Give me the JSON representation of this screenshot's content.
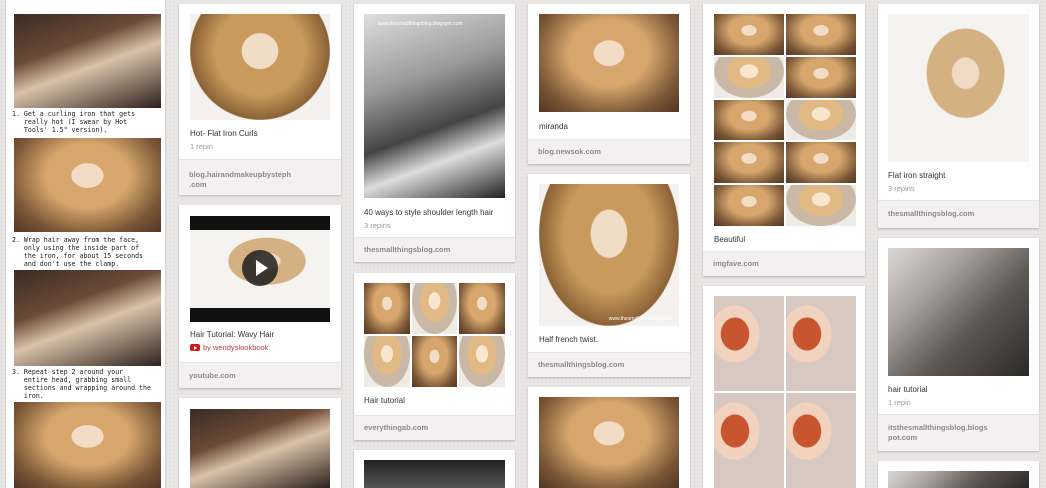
{
  "pins": {
    "c1": {
      "step1": "1. Get a curling iron that gets\n   really hot (I swear by Hot\n   Tools' 1.5\" version).",
      "step2": "2. Wrap hair away from the face,\n   only using the inside part of\n   the iron, for about 15 seconds\n   and don't use the clamp.",
      "step3": "3. Repeat step 2 around your\n   entire head, grabbing small\n   sections and wrapping around the\n   iron."
    },
    "c2a": {
      "desc": "Hot- Flat Iron Curls",
      "repins": "1 repin",
      "source": "blog.hairandmakeupbysteph\n.com"
    },
    "c2b": {
      "desc": "Hair Tutorial: Wavy Hair",
      "via": "by wendyslookbook",
      "source": "youtube.com"
    },
    "c3a": {
      "watermark": "www.thesmallthingsblog.blogspot.com",
      "desc": "40 ways to style shoulder length hair",
      "repins": "3 repins",
      "source": "thesmallthingsblog.com"
    },
    "c3b": {
      "desc": "Hair tutorial",
      "source": "everythingab.com"
    },
    "c4a": {
      "desc": "miranda",
      "source": "blog.newsok.com"
    },
    "c4b": {
      "watermark": "www.thesmallthingsblog.com",
      "desc": "Half french twist.",
      "source": "thesmallthingsblog.com"
    },
    "c5a": {
      "desc": "Beautiful",
      "source": "imgfave.com"
    },
    "c6a": {
      "desc": "Flat iron straight",
      "repins": "3 repins",
      "source": "thesmallthingsblog.com"
    },
    "c6b": {
      "desc": "hair tutorial",
      "repins": "1 repin",
      "source": "itsthesmallthingsblog.blogs\npot.com"
    }
  },
  "colors": {
    "source_bar": "#f2f0f0",
    "youtube_red": "#cc181e"
  }
}
